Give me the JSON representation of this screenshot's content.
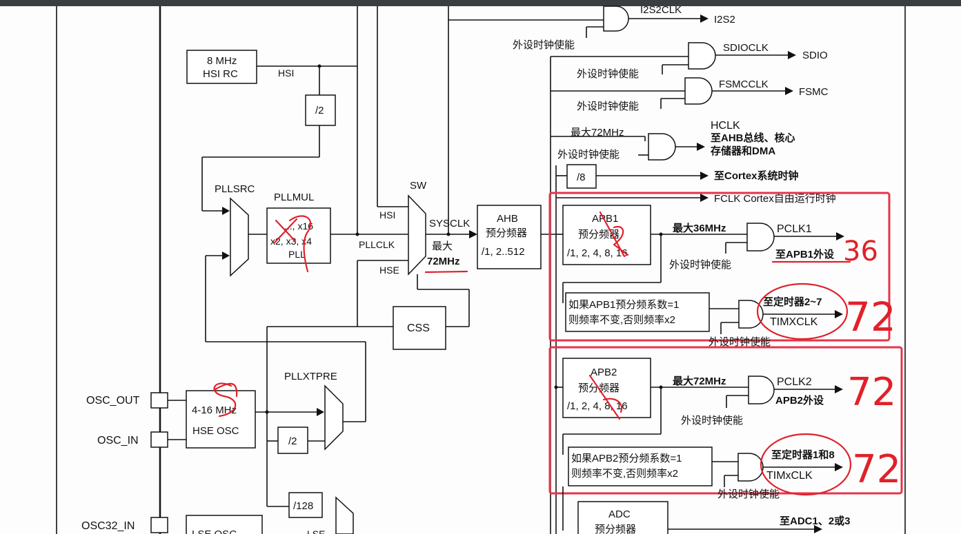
{
  "colors": {
    "topbar": "#3a3d42",
    "line": "#111111",
    "annotation_red": "#e0202a",
    "frame_red": "#e8334a"
  },
  "icons": [
    "and-gate",
    "mux",
    "arrow"
  ],
  "labels": {
    "i2s2clk": "I2S2CLK",
    "i2s2": "I2S2",
    "peri_en": "外设时钟使能",
    "sdioclk": "SDIOCLK",
    "sdio": "SDIO",
    "fsmcclk": "FSMCCLK",
    "fsmc": "FSMC",
    "hsi_rc_1": "8 MHz",
    "hsi_rc_2": "HSI RC",
    "hsi": "HSI",
    "div2": "/2",
    "pllsrc": "PLLSRC",
    "pllmul": "PLLMUL",
    "pll_x16": "..., x16",
    "pll_mul": "x2, x3, x4",
    "pll": "PLL",
    "sw": "SW",
    "sw_hsi": "HSI",
    "sysclk": "SYSCLK",
    "pllclk": "PLLCLK",
    "sw_hse": "HSE",
    "max": "最大",
    "max72": "72MHz",
    "ahb": "AHB",
    "prescaler": "预分频器",
    "ahb_div": "/1, 2..512",
    "hclk": "HCLK",
    "hclk_dest_1": "至AHB总线、核心",
    "hclk_dest_2": "存储器和DMA",
    "max72_label": "最大72MHz",
    "div8": "/8",
    "cortex_clk": "至Cortex系统时钟",
    "fclk": "FCLK Cortex自由运行时钟",
    "apb1": "APB1",
    "apb_div": "/1, 2, 4, 8, 16",
    "max36_label": "最大36MHz",
    "pclk1": "PCLK1",
    "apb1_dest": "至APB1外设",
    "apb1_cond_1": "如果APB1预分频系数=1",
    "apb_cond_2": "则频率不变,否则频率x2",
    "tim27": "至定时器2~7",
    "timxclk_upper": "TIMXCLK",
    "apb2": "APB2",
    "pclk2": "PCLK2",
    "apb2_dest": "APB2外设",
    "apb2_cond_1": "如果APB2预分频系数=1",
    "tim18": "至定时器1和8",
    "timxclk_lower": "TIMxCLK",
    "css": "CSS",
    "pllxtpre": "PLLXTPRE",
    "osc_out": "OSC_OUT",
    "osc_in": "OSC_IN",
    "hse_osc_1": "4-16 MHz",
    "hse_osc_2": "HSE OSC",
    "div128": "/128",
    "osc32_in": "OSC32_IN",
    "lse_osc": "LSE OSC",
    "lse": "LSE",
    "adc": "ADC",
    "adc_dest": "至ADC1、2或3"
  },
  "handwriting": {
    "apb1_pclk1": "36",
    "apb1_tim": "72",
    "apb2_pclk2": "72",
    "apb2_tim": "72"
  }
}
